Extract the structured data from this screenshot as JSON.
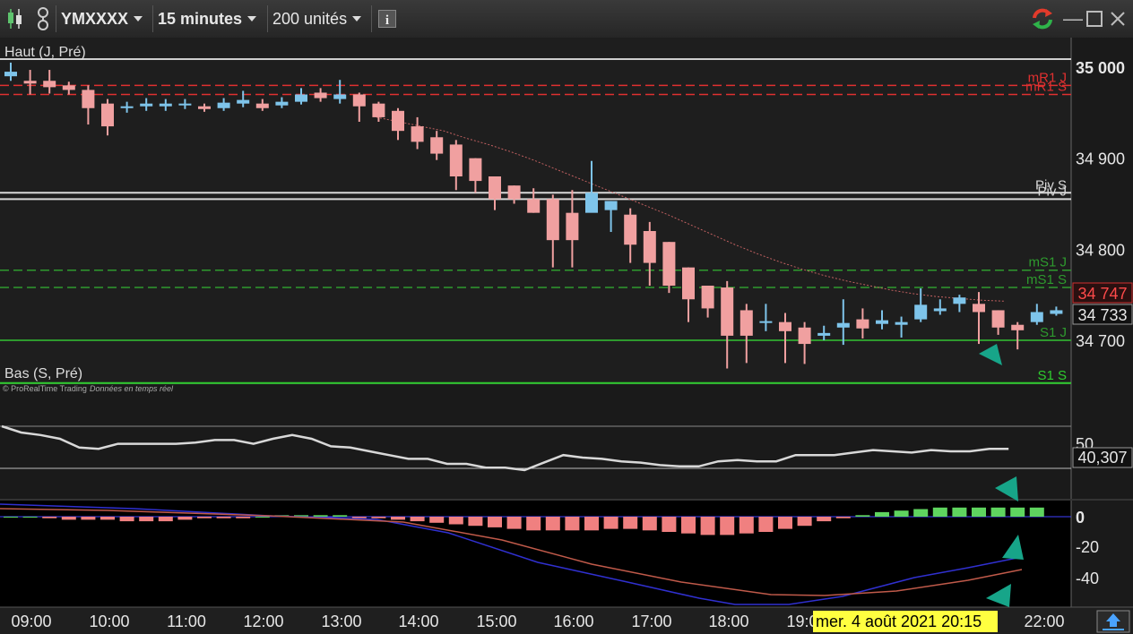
{
  "toolbar": {
    "instrument": "YMXXXX",
    "timeframe": "15 minutes",
    "units": "200 unités",
    "info_icon": "info-icon"
  },
  "price_panel": {
    "top_label": "Haut (J, Pré)",
    "bottom_label": "Bas (S, Pré)",
    "copyright": "© ProRealTime Trading",
    "realtime": "Données en temps réel",
    "levels": [
      {
        "name": "mR1 J",
        "value": 34980,
        "color": "#e03030",
        "style": "dash"
      },
      {
        "name": "mR1 S",
        "value": 34970,
        "color": "#e03030",
        "style": "dash"
      },
      {
        "name": "Piv J",
        "value": 34855,
        "color": "#d8d8d8",
        "style": "solid"
      },
      {
        "name": "Piv S",
        "value": 34862,
        "color": "#d8d8d8",
        "style": "solid"
      },
      {
        "name": "mS1 J",
        "value": 34777,
        "color": "#2e9a2e",
        "style": "dash"
      },
      {
        "name": "mS1 S",
        "value": 34758,
        "color": "#2e9a2e",
        "style": "dash"
      },
      {
        "name": "S1 J",
        "value": 34700,
        "color": "#2e9a2e",
        "style": "solid"
      },
      {
        "name": "S1 S",
        "value": 34653,
        "color": "#2ecc2e",
        "style": "solid"
      }
    ],
    "price_ticks": [
      "35 000",
      "34 900",
      "34 800",
      "34 700"
    ],
    "price_tick_values": [
      35000,
      34900,
      34800,
      34700
    ],
    "last_price_red": "34 747",
    "last_price_dark": "34 733"
  },
  "rsi_panel": {
    "tick": "50",
    "value": "40,307"
  },
  "macd_panel": {
    "ticks": [
      "0",
      "-20",
      "-40"
    ]
  },
  "time_axis": {
    "labels": [
      "09:00",
      "10:00",
      "11:00",
      "12:00",
      "13:00",
      "14:00",
      "15:00",
      "16:00",
      "17:00",
      "18:00",
      "19:00",
      "22:00"
    ],
    "crosshair_label": "mer. 4 août 2021 20:15"
  },
  "chart_data": {
    "type": "candlestick",
    "y_range": [
      34645,
      35010
    ],
    "candles": [
      [
        34990,
        34995,
        34985,
        35005
      ],
      [
        34985,
        34982,
        34970,
        34997
      ],
      [
        34985,
        34978,
        34971,
        34997
      ],
      [
        34980,
        34975,
        34970,
        34984
      ],
      [
        34975,
        34955,
        34937,
        34980
      ],
      [
        34960,
        34935,
        34925,
        34965
      ],
      [
        34955,
        34957,
        34950,
        34962
      ],
      [
        34957,
        34960,
        34952,
        34966
      ],
      [
        34957,
        34960,
        34952,
        34965
      ],
      [
        34958,
        34960,
        34954,
        34965
      ],
      [
        34957,
        34954,
        34951,
        34960
      ],
      [
        34955,
        34961,
        34952,
        34966
      ],
      [
        34960,
        34964,
        34956,
        34974
      ],
      [
        34960,
        34955,
        34952,
        34965
      ],
      [
        34958,
        34962,
        34955,
        34967
      ],
      [
        34962,
        34970,
        34959,
        34977
      ],
      [
        34972,
        34966,
        34962,
        34977
      ],
      [
        34965,
        34970,
        34960,
        34986
      ],
      [
        34970,
        34957,
        34940,
        34972
      ],
      [
        34960,
        34945,
        34940,
        34962
      ],
      [
        34952,
        34930,
        34920,
        34955
      ],
      [
        34935,
        34918,
        34910,
        34945
      ],
      [
        34923,
        34905,
        34898,
        34930
      ],
      [
        34915,
        34880,
        34865,
        34920
      ],
      [
        34900,
        34875,
        34862,
        34900
      ],
      [
        34880,
        34855,
        34843,
        34880
      ],
      [
        34870,
        34855,
        34850,
        34870
      ],
      [
        34855,
        34840,
        34840,
        34867
      ],
      [
        34855,
        34810,
        34780,
        34860
      ],
      [
        34840,
        34810,
        34780,
        34865
      ],
      [
        34840,
        34862,
        34843,
        34897
      ],
      [
        34843,
        34853,
        34819,
        34853
      ],
      [
        34838,
        34805,
        34785,
        34845
      ],
      [
        34820,
        34785,
        34760,
        34830
      ],
      [
        34808,
        34760,
        34752,
        34808
      ],
      [
        34780,
        34745,
        34720,
        34780
      ],
      [
        34760,
        34735,
        34725,
        34760
      ],
      [
        34758,
        34705,
        34669,
        34765
      ],
      [
        34733,
        34705,
        34675,
        34740
      ],
      [
        34720,
        34721,
        34710,
        34740
      ],
      [
        34720,
        34710,
        34675,
        34730
      ],
      [
        34714,
        34696,
        34674,
        34720
      ],
      [
        34705,
        34708,
        34700,
        34716
      ],
      [
        34714,
        34719,
        34695,
        34745
      ],
      [
        34723,
        34713,
        34702,
        34735
      ],
      [
        34718,
        34722,
        34712,
        34733
      ],
      [
        34717,
        34720,
        34703,
        34726
      ],
      [
        34723,
        34739,
        34720,
        34757
      ],
      [
        34732,
        34735,
        34728,
        34745
      ],
      [
        34740,
        34747,
        34731,
        34750
      ],
      [
        34740,
        34731,
        34696,
        34753
      ],
      [
        34733,
        34714,
        34706,
        34733
      ],
      [
        34717,
        34711,
        34690,
        34720
      ],
      [
        34720,
        34731,
        34717,
        34740
      ],
      [
        34729,
        34733,
        34727,
        34737
      ]
    ],
    "ma": [
      34945,
      34940,
      34935,
      34930,
      34922,
      34915,
      34907,
      34898,
      34888,
      34878,
      34868,
      34858,
      34848,
      34838,
      34827,
      34816,
      34805,
      34795,
      34786,
      34778,
      34771,
      34765,
      34760,
      34755,
      34751,
      34748,
      34746,
      34744,
      34743
    ],
    "rsi": [
      70,
      65,
      63,
      60,
      53,
      52,
      56,
      56,
      56,
      56,
      57,
      59,
      59,
      56,
      60,
      63,
      60,
      54,
      53,
      50,
      47,
      44,
      44,
      40,
      40,
      37,
      37,
      35,
      41,
      47,
      45,
      44,
      42,
      41,
      39,
      38,
      38,
      42,
      43,
      42,
      42,
      47,
      47,
      47,
      49,
      51,
      50,
      49,
      51,
      50,
      50,
      52,
      52
    ],
    "macd_hist": [
      0,
      0,
      -1,
      -2,
      -2,
      -2,
      -3,
      -3,
      -3,
      -2,
      -1,
      -1,
      -1,
      0,
      1,
      1,
      1,
      1,
      -1,
      -1,
      -2,
      -3,
      -4,
      -5,
      -6,
      -7,
      -8,
      -9,
      -9,
      -9,
      -9,
      -8,
      -8,
      -9,
      -10,
      -11,
      -12,
      -12,
      -11,
      -10,
      -8,
      -6,
      -3,
      -1,
      1,
      3,
      4,
      5,
      6,
      6,
      6,
      6,
      6,
      6
    ]
  }
}
